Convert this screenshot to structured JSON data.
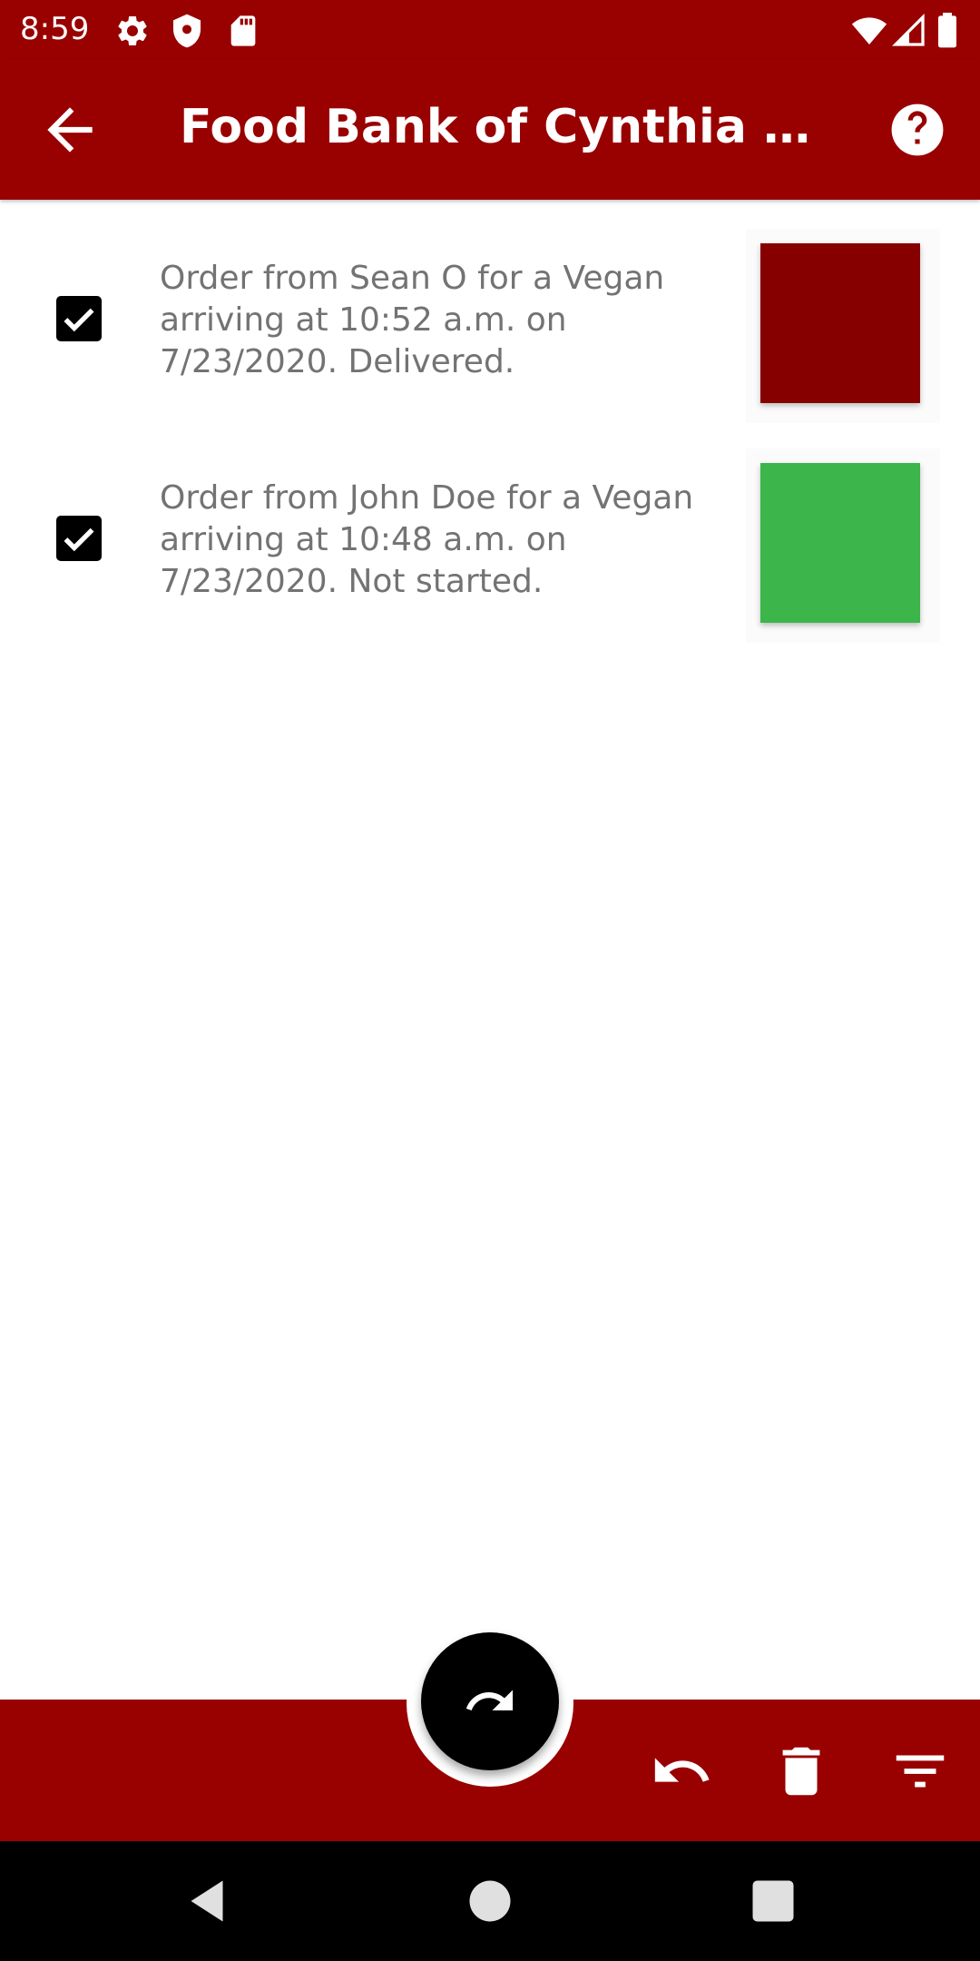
{
  "status_bar": {
    "time": "8:59",
    "icons": [
      "settings-icon",
      "shield-icon",
      "sd-card-icon",
      "wifi-icon",
      "signal-icon",
      "battery-icon"
    ]
  },
  "app_bar": {
    "title": "Food Bank of Cynthia H. H...",
    "back_icon": "arrow-back-icon",
    "help_icon": "help-icon"
  },
  "orders": [
    {
      "text": "Order from Sean O for a Vegan arriving at 10:52 a.m. on 7/23/2020. Delivered.",
      "checked": true,
      "status_color": "#870000"
    },
    {
      "text": "Order from John Doe for a Vegan arriving at 10:48 a.m. on 7/23/2020. Not started.",
      "checked": true,
      "status_color": "#3cb54b"
    }
  ],
  "bottom_bar": {
    "fab_icon": "redo-icon",
    "actions": [
      "undo-icon",
      "delete-icon",
      "filter-icon"
    ]
  },
  "colors": {
    "primary": "#990000",
    "text_secondary": "#737373"
  }
}
